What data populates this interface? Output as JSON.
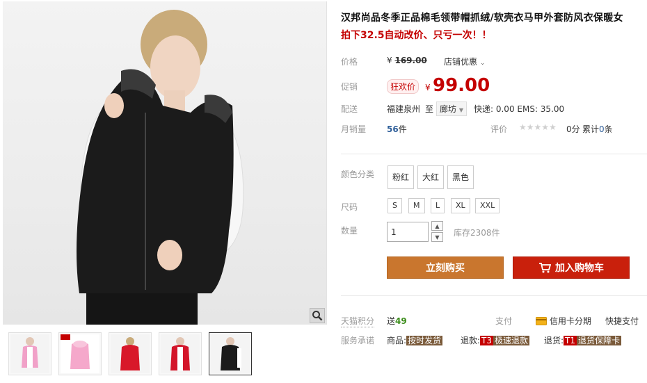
{
  "product": {
    "title": "汉邦尚品冬季正品棉毛领带帽抓绒/软壳衣马甲外套防风衣保暖女",
    "subtitle": "拍下32.5自动改价、只亏一次！！"
  },
  "price": {
    "label": "价格",
    "currency": "¥",
    "original": "169.00",
    "store_discount": "店铺优惠"
  },
  "promotion": {
    "label": "促销",
    "badge": "狂欢价",
    "currency": "¥",
    "price": "99.00"
  },
  "shipping": {
    "label": "配送",
    "from": "福建泉州",
    "to_prefix": "至",
    "destination": "廊坊",
    "fees": "快递: 0.00 EMS: 35.00"
  },
  "sales": {
    "label": "月销量",
    "count": "56",
    "unit": "件",
    "rating_label": "评价",
    "score": "0分",
    "review_prefix": "累计",
    "review_count": "0",
    "review_unit": "条"
  },
  "options": {
    "color_label": "颜色分类",
    "colors": [
      "粉红",
      "大红",
      "黑色"
    ],
    "size_label": "尺码",
    "sizes": [
      "S",
      "M",
      "L",
      "XL",
      "XXL"
    ],
    "qty_label": "数量",
    "qty_value": "1",
    "stock": "库存2308件"
  },
  "actions": {
    "buy_now": "立刻购买",
    "add_to_cart": "加入购物车"
  },
  "points": {
    "label": "天猫积分",
    "prefix": "送",
    "value": "49",
    "pay_label": "支付",
    "credit": "信用卡分期",
    "quick": "快捷支付"
  },
  "service": {
    "label": "服务承诺",
    "goods_prefix": "商品:",
    "goods_tag": "按时发货",
    "refund_prefix": "退款:",
    "refund_code": "T3",
    "refund_tag": "极速退款",
    "return_prefix": "退货:",
    "return_code": "T1",
    "return_tag": "退货保障卡"
  },
  "icons": {
    "zoom": "magnifier-icon",
    "cart": "cart-icon",
    "credit": "credit-card-icon",
    "dropdown": "chevron-down-icon"
  },
  "colors": {
    "price_red": "#c40000",
    "buy_orange": "#c9762e",
    "cart_red": "#c9200c",
    "link_blue": "#2f5f9a"
  }
}
